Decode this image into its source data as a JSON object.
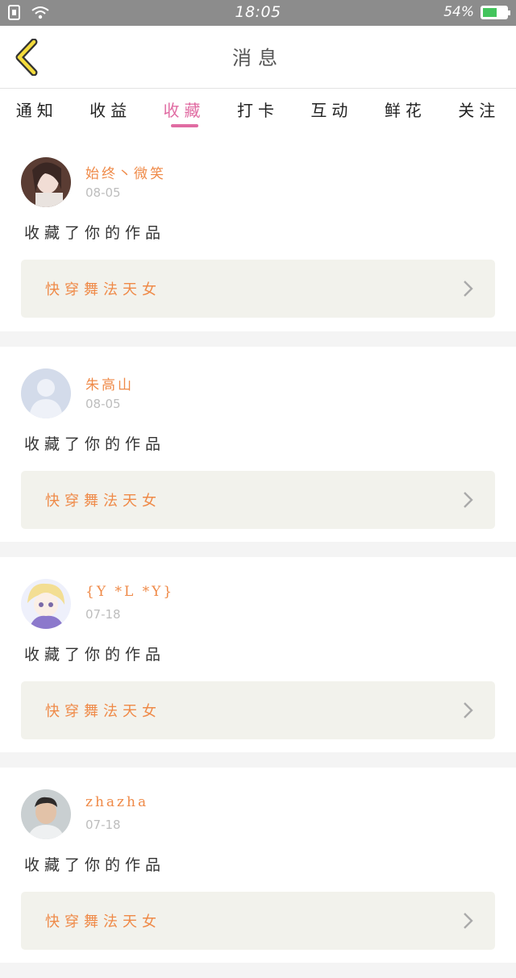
{
  "status_bar": {
    "time": "18:05",
    "battery": "54%",
    "icons": [
      "sim-icon",
      "wifi-icon",
      "battery-icon"
    ]
  },
  "header": {
    "title": "消息",
    "back_icon": "chevron-left-icon"
  },
  "tabs": [
    {
      "label": "通知",
      "active": false
    },
    {
      "label": "收益",
      "active": false
    },
    {
      "label": "收藏",
      "active": true
    },
    {
      "label": "打卡",
      "active": false
    },
    {
      "label": "互动",
      "active": false
    },
    {
      "label": "鲜花",
      "active": false
    },
    {
      "label": "关注",
      "active": false
    }
  ],
  "colors": {
    "accent": "#e06ba2",
    "name": "#ef8a48",
    "work_bg": "#f2f2ec"
  },
  "items": [
    {
      "user": "始终丶微笑",
      "date": "08-05",
      "action": "收藏了你的作品",
      "work": "快穿舞法天女"
    },
    {
      "user": "朱高山",
      "date": "08-05",
      "action": "收藏了你的作品",
      "work": "快穿舞法天女"
    },
    {
      "user": "{Y *L *Y}",
      "date": "07-18",
      "action": "收藏了你的作品",
      "work": "快穿舞法天女"
    },
    {
      "user": "zhazha",
      "date": "07-18",
      "action": "收藏了你的作品",
      "work": "快穿舞法天女"
    }
  ]
}
